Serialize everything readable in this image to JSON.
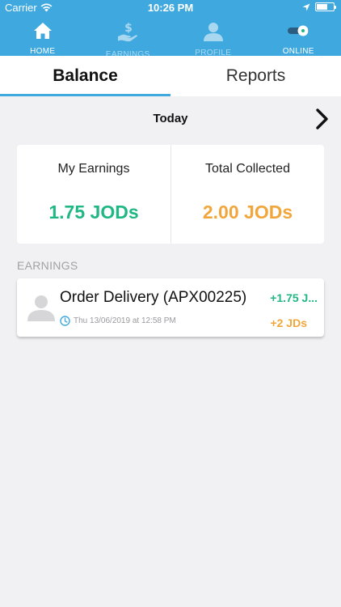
{
  "status_bar": {
    "carrier": "Carrier",
    "time": "10:26 PM",
    "icons": [
      "wifi-icon",
      "location-arrow-icon",
      "battery-icon"
    ]
  },
  "nav": {
    "accent_color": "#3fa9df",
    "items": [
      {
        "label": "HOME",
        "icon": "home-icon"
      },
      {
        "label": "EARNINGS",
        "icon": "hand-dollar-icon"
      },
      {
        "label": "PROFILE",
        "icon": "person-icon"
      },
      {
        "label": "ONLINE",
        "icon": "toggle-icon"
      }
    ]
  },
  "tabs": [
    {
      "label": "Balance",
      "active": true
    },
    {
      "label": "Reports",
      "active": false
    }
  ],
  "date_nav": {
    "label": "Today"
  },
  "summary": {
    "earnings_title": "My Earnings",
    "earnings_value": "1.75 JODs",
    "earnings_color": "#1fb784",
    "collected_title": "Total Collected",
    "collected_value": "2.00 JODs",
    "collected_color": "#f1a63b"
  },
  "section_title": "EARNINGS",
  "earnings_list": [
    {
      "title": "Order Delivery (APX00225)",
      "datetime": "Thu 13/06/2019 at 12:58 PM",
      "earning": "+1.75 J...",
      "collected": "+2 JDs"
    }
  ]
}
